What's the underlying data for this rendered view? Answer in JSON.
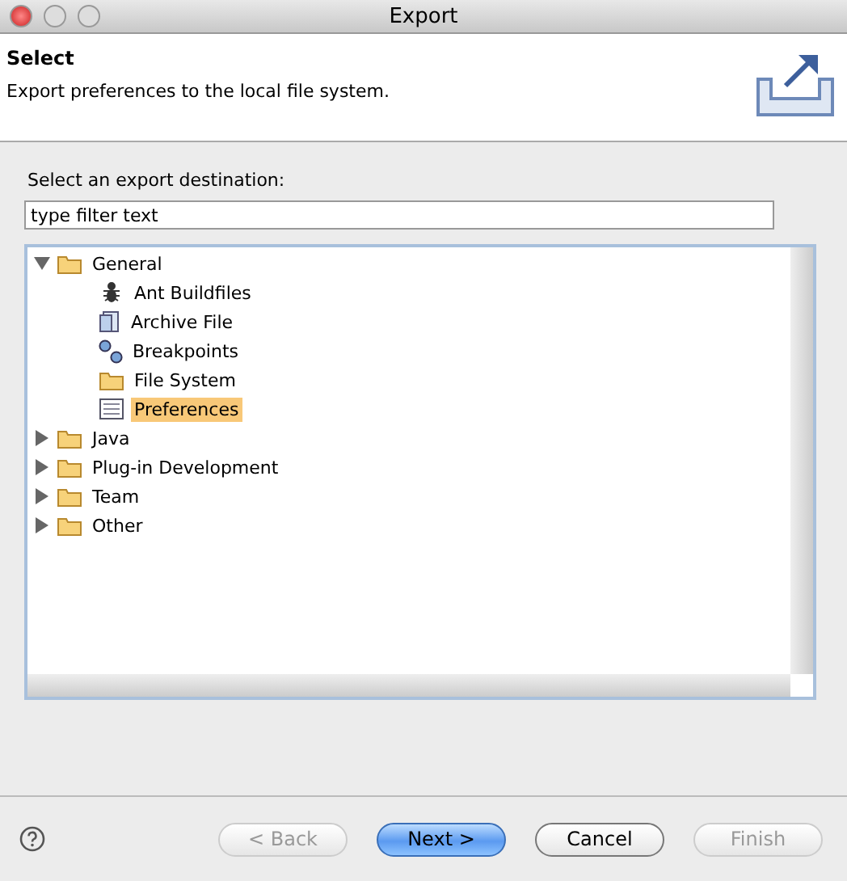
{
  "window": {
    "title": "Export"
  },
  "header": {
    "title": "Select",
    "description": "Export preferences to the local file system."
  },
  "destination_label": "Select an export destination:",
  "filter": {
    "value": "type filter text"
  },
  "tree": [
    {
      "label": "General",
      "kind": "folder",
      "expanded": true,
      "selected": false,
      "children": [
        {
          "label": "Ant Buildfiles",
          "kind": "ant",
          "selected": false
        },
        {
          "label": "Archive File",
          "kind": "archive",
          "selected": false
        },
        {
          "label": "Breakpoints",
          "kind": "breakpoints",
          "selected": false
        },
        {
          "label": "File System",
          "kind": "folder",
          "selected": false
        },
        {
          "label": "Preferences",
          "kind": "preferences",
          "selected": true
        }
      ]
    },
    {
      "label": "Java",
      "kind": "folder",
      "expanded": false,
      "selected": false
    },
    {
      "label": "Plug-in Development",
      "kind": "folder",
      "expanded": false,
      "selected": false
    },
    {
      "label": "Team",
      "kind": "folder",
      "expanded": false,
      "selected": false
    },
    {
      "label": "Other",
      "kind": "folder",
      "expanded": false,
      "selected": false
    }
  ],
  "buttons": [
    {
      "label": "< Back",
      "disabled": true,
      "default": false
    },
    {
      "label": "Next >",
      "disabled": false,
      "default": true
    },
    {
      "label": "Cancel",
      "disabled": false,
      "default": false
    },
    {
      "label": "Finish",
      "disabled": true,
      "default": false
    }
  ]
}
